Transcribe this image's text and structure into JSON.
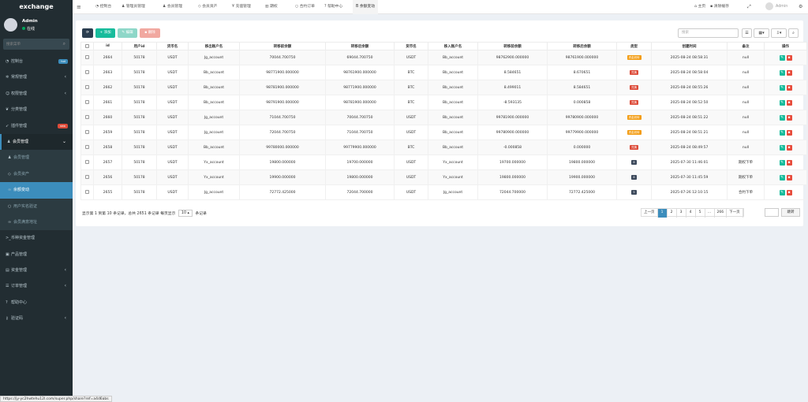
{
  "app": {
    "title": "exchange"
  },
  "user": {
    "name": "Admin",
    "status": "在线",
    "avatar_color": "#d2d6de"
  },
  "sidebar": {
    "search_placeholder": "搜索菜单",
    "items": [
      {
        "label": "控制台",
        "icon": "dashboard-icon",
        "badge": "hot",
        "badge_color": "#3c8dbc"
      },
      {
        "label": "常规管理",
        "icon": "cogs-icon",
        "arrow": "‹"
      },
      {
        "label": "权限管理",
        "icon": "group-icon",
        "arrow": "‹"
      },
      {
        "label": "分类管理",
        "icon": "leaf-icon"
      },
      {
        "label": "插件管理",
        "icon": "rocket-icon",
        "badge": "new",
        "badge_color": "#dd4b39"
      },
      {
        "label": "会员管理",
        "icon": "user-icon",
        "arrow": "⌄",
        "open": true
      },
      {
        "label": "会员管理",
        "icon": "user-icon",
        "sub": true
      },
      {
        "label": "会员资产",
        "icon": "diamond-icon",
        "sub": true
      },
      {
        "label": "余额变动",
        "icon": "link-icon",
        "sub": true,
        "active": true
      },
      {
        "label": "用户实名验证",
        "icon": "circle-icon",
        "sub": true
      },
      {
        "label": "会员满意地址",
        "icon": "link-icon",
        "sub": true
      },
      {
        "label": "币种资金管理",
        "icon": "terminal-icon"
      },
      {
        "label": "产品管理",
        "icon": "cubes-icon"
      },
      {
        "label": "资金管理",
        "icon": "money-icon",
        "arrow": "‹"
      },
      {
        "label": "订单管理",
        "icon": "list-icon",
        "arrow": "‹"
      },
      {
        "label": "帮助中心",
        "icon": "question-icon"
      },
      {
        "label": "验证码",
        "icon": "key-icon",
        "arrow": "‹"
      }
    ]
  },
  "topbar": {
    "tabs": [
      {
        "label": "控制台",
        "icon": "dashboard-icon"
      },
      {
        "label": "管理员管理",
        "icon": "user-icon"
      },
      {
        "label": "会员管理",
        "icon": "user-icon"
      },
      {
        "label": "会员资产",
        "icon": "diamond-icon"
      },
      {
        "label": "充值管理",
        "icon": "yen-icon"
      },
      {
        "label": "期权",
        "icon": "chart-icon"
      },
      {
        "label": "合约订单",
        "icon": "circle-icon"
      },
      {
        "label": "帮助中心",
        "icon": "question-icon"
      },
      {
        "label": "余额变动",
        "icon": "bitcoin-icon",
        "active": true
      }
    ],
    "home_label": "主页",
    "clear_cache_label": "清除缓存",
    "user_label": "Admin"
  },
  "toolbar": {
    "add_label": "添加",
    "edit_label": "编辑",
    "delete_label": "删除",
    "search_placeholder": "搜索"
  },
  "table": {
    "headers": [
      "",
      "id",
      "用户id",
      "货币名",
      "移出账户名",
      "转移前余额",
      "转移后余额",
      "货币名",
      "移入账户名",
      "转移前余额",
      "转移后余额",
      "类型",
      "创建时间",
      "备注",
      "操作"
    ],
    "rows": [
      {
        "id": "2664",
        "uid": "50178",
        "c1": "USDT",
        "from": "Jg_account",
        "b1": "70044.700750",
        "a1": "69044.700750",
        "c2": "USDT",
        "to": "Bb_account",
        "b2": "98762900.000000",
        "a2": "98761900.000000",
        "type": "资金划转",
        "type_color": "#f39c12",
        "time": "2025-08-24 08:58:31",
        "note": "null"
      },
      {
        "id": "2663",
        "uid": "50178",
        "c1": "USDT",
        "from": "Bb_account",
        "b1": "98771900.000000",
        "a1": "98761900.000000",
        "c2": "BTC",
        "to": "Bb_account",
        "b2": "8.584651",
        "a2": "8.670651",
        "type": "兑换",
        "type_color": "#dd4b39",
        "time": "2025-08-24 08:58:04",
        "note": "null"
      },
      {
        "id": "2662",
        "uid": "50178",
        "c1": "USDT",
        "from": "Bb_account",
        "b1": "98781900.000000",
        "a1": "98771900.000000",
        "c2": "BTC",
        "to": "Bb_account",
        "b2": "8.499011",
        "a2": "8.584651",
        "type": "兑换",
        "type_color": "#dd4b39",
        "time": "2025-08-24 08:55:26",
        "note": "null"
      },
      {
        "id": "2661",
        "uid": "50178",
        "c1": "USDT",
        "from": "Bb_account",
        "b1": "98791900.000000",
        "a1": "98781900.000000",
        "c2": "BTC",
        "to": "Bb_account",
        "b2": "-8.593135",
        "a2": "0.000858",
        "type": "兑换",
        "type_color": "#dd4b39",
        "time": "2025-08-24 08:52:50",
        "note": "null"
      },
      {
        "id": "2660",
        "uid": "50178",
        "c1": "USDT",
        "from": "Jg_account",
        "b1": "71044.700750",
        "a1": "70044.700750",
        "c2": "USDT",
        "to": "Bb_account",
        "b2": "99781900.000000",
        "a2": "99780900.000000",
        "type": "资金划转",
        "type_color": "#f39c12",
        "time": "2025-08-24 08:51:22",
        "note": "null"
      },
      {
        "id": "2659",
        "uid": "50178",
        "c1": "USDT",
        "from": "Jg_account",
        "b1": "72044.700750",
        "a1": "71044.700750",
        "c2": "USDT",
        "to": "Bb_account",
        "b2": "99780900.000000",
        "a2": "99779900.000000",
        "type": "资金划转",
        "type_color": "#f39c12",
        "time": "2025-08-24 08:51:21",
        "note": "null"
      },
      {
        "id": "2658",
        "uid": "50178",
        "c1": "USDT",
        "from": "Bb_account",
        "b1": "99780000.000000",
        "a1": "99779900.000000",
        "c2": "BTC",
        "to": "Bb_account",
        "b2": "-0.000858",
        "a2": "0.000000",
        "type": "兑换",
        "type_color": "#dd4b39",
        "time": "2025-08-24 08:49:57",
        "note": "null"
      },
      {
        "id": "2657",
        "uid": "50178",
        "c1": "USDT",
        "from": "Yx_account",
        "b1": "19800.000000",
        "a1": "19700.000000",
        "c2": "USDT",
        "to": "Yx_account",
        "b2": "19700.000000",
        "a2": "19800.000000",
        "type": "8",
        "type_color": "#3d4a5c",
        "time": "2025-07-30 11:46:01",
        "note": "期权下单"
      },
      {
        "id": "2656",
        "uid": "50178",
        "c1": "USDT",
        "from": "Yx_account",
        "b1": "19900.000000",
        "a1": "19800.000000",
        "c2": "USDT",
        "to": "Yx_account",
        "b2": "19800.000000",
        "a2": "19900.000000",
        "type": "8",
        "type_color": "#3d4a5c",
        "time": "2025-07-30 11:45:59",
        "note": "期权下单"
      },
      {
        "id": "2655",
        "uid": "50178",
        "c1": "USDT",
        "from": "Jg_account",
        "b1": "72772.425000",
        "a1": "72044.700000",
        "c2": "USDT",
        "to": "Jg_account",
        "b2": "72044.700000",
        "a2": "72772.425000",
        "type": "5",
        "type_color": "#3d4a5c",
        "time": "2025-07-26 12:10:15",
        "note": "合约下单"
      }
    ]
  },
  "pagination": {
    "info_prefix": "显示第 1 到第 10 条记录，总共 2651 条记录 每页显示",
    "page_size": "10",
    "info_suffix": "条记录",
    "prev_label": "上一页",
    "pages": [
      "1",
      "2",
      "3",
      "4",
      "5",
      "...",
      "266"
    ],
    "next_label": "下一页",
    "jump_label": "跳转"
  },
  "statusbar": {
    "url": "https://jy-yc2hwtehu12l.com/super.php/share?ref=a4d6abs"
  },
  "colors": {
    "primary": "#3c8dbc",
    "success": "#18bc9c",
    "danger": "#e74c3c",
    "warning": "#f39c12",
    "sidebar_bg": "#222d32"
  }
}
